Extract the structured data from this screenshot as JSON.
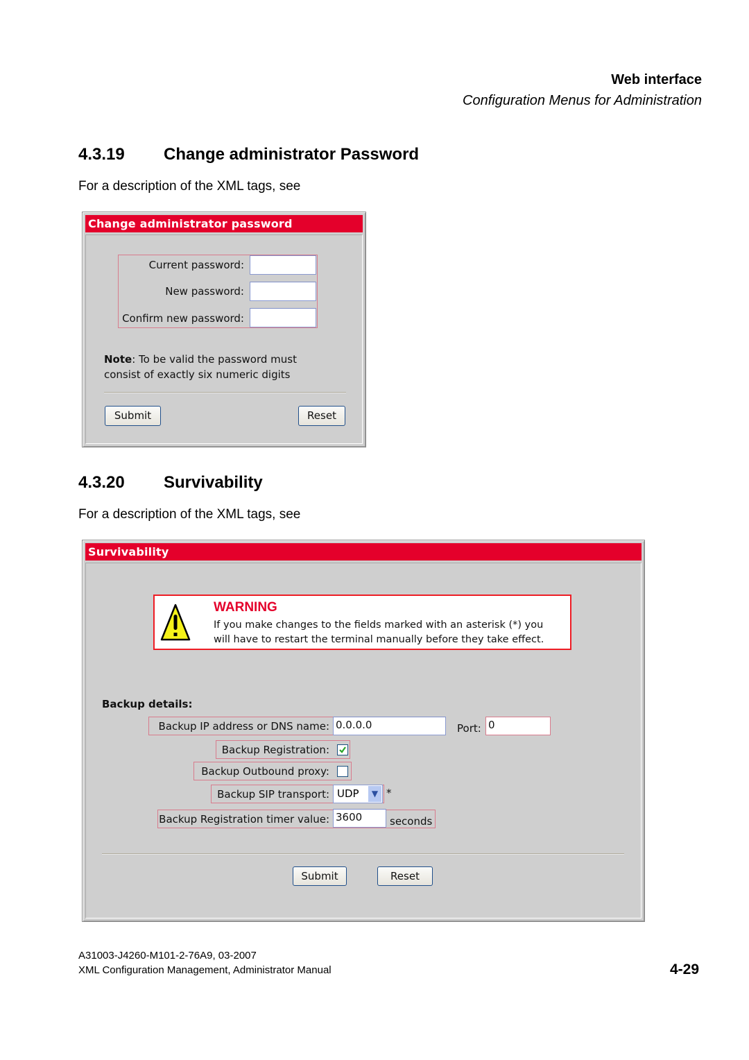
{
  "header": {
    "section": "Web interface",
    "chapter": "Configuration Menus for Administration"
  },
  "sections": [
    {
      "number": "4.3.19",
      "title": "Change administrator Password",
      "intro": "For a description of the XML tags, see"
    },
    {
      "number": "4.3.20",
      "title": "Survivability",
      "intro": "For a description of the XML tags, see"
    }
  ],
  "password_panel": {
    "title": "Change administrator password",
    "fields": [
      {
        "label": "Current password:",
        "value": ""
      },
      {
        "label": "New password:",
        "value": ""
      },
      {
        "label": "Confirm new password:",
        "value": ""
      }
    ],
    "note_bold": "Note",
    "note_line1": ": To be valid the password must",
    "note_line2": "consist of exactly six numeric digits",
    "submit_label": "Submit",
    "reset_label": "Reset"
  },
  "survivability_panel": {
    "title": "Survivability",
    "warning": {
      "icon": "warning-triangle-icon",
      "title": "WARNING",
      "line1": "If you make changes to the fields marked with an asterisk (*) you",
      "line2": "will have to restart the terminal manually before they take effect."
    },
    "backup_heading": "Backup details:",
    "ip_label": "Backup IP address or DNS name:",
    "ip_value": "0.0.0.0",
    "port_label": "Port:",
    "port_value": "0",
    "registration_label": "Backup Registration:",
    "registration_checked": true,
    "outbound_label": "Backup Outbound proxy:",
    "outbound_checked": false,
    "transport_label": "Backup SIP transport:",
    "transport_value": "UDP",
    "transport_marker": "*",
    "timer_label": "Backup Registration timer value:",
    "timer_value": "3600",
    "timer_unit": "seconds",
    "submit_label": "Submit",
    "reset_label": "Reset"
  },
  "footer": {
    "doc_code": "A31003-J4260-M101-2-76A9, 03-2007",
    "doc_title": "XML Configuration Management, Administrator Manual",
    "page": "4-29"
  },
  "colors": {
    "panel_title_bar": "#e4002b",
    "panel_background": "#cfcfcf",
    "warning_border": "#ee1c24"
  }
}
